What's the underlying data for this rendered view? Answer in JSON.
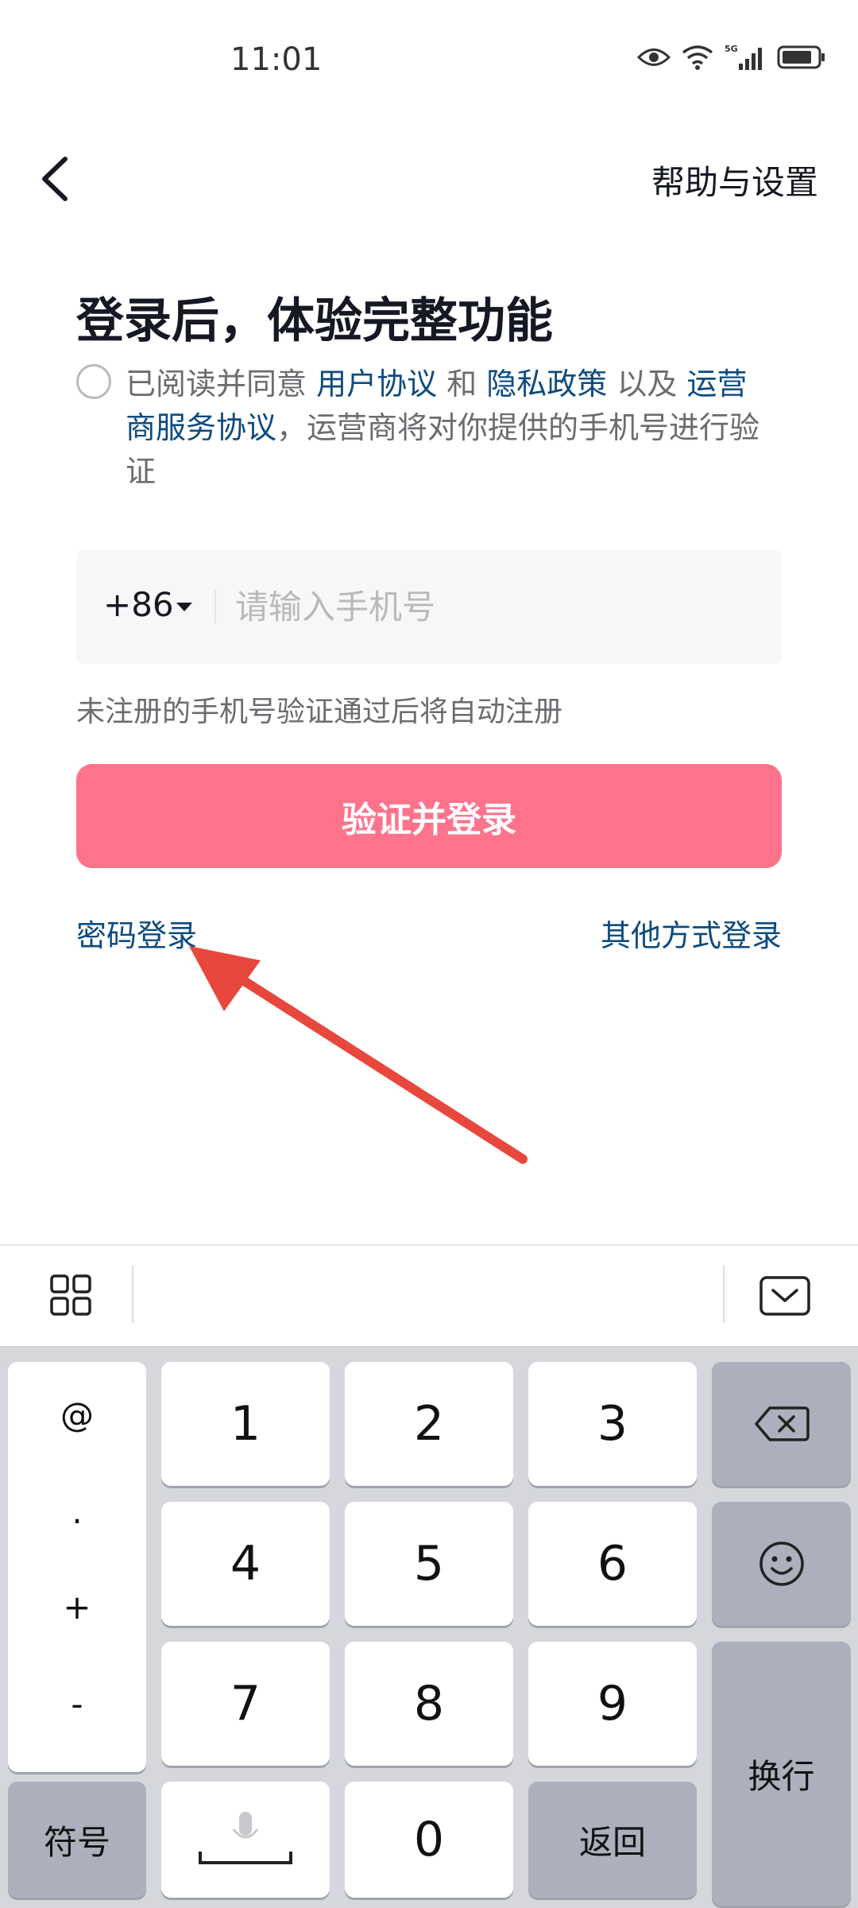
{
  "status_bar": {
    "time": "11:01"
  },
  "header": {
    "help": "帮助与设置"
  },
  "title": "登录后，体验完整功能",
  "agreement": {
    "part1": "已阅读并同意 ",
    "user_agreement": "用户协议",
    "and": " 和 ",
    "privacy_policy": "隐私政策",
    "and_also": " 以及 ",
    "operator_agreement": "运营商服务协议",
    "part2": "，运营商将对你提供的手机号进行验证"
  },
  "phone": {
    "country_code": "+86",
    "placeholder": "请输入手机号"
  },
  "hint": "未注册的手机号验证通过后将自动注册",
  "login_button": "验证并登录",
  "password_login": "密码登录",
  "other_login": "其他方式登录",
  "keyboard": {
    "symbols": [
      "@",
      ".",
      "+",
      "-"
    ],
    "digits": [
      "1",
      "2",
      "3",
      "4",
      "5",
      "6",
      "7",
      "8",
      "9",
      "0"
    ],
    "symbol_key": "符号",
    "back_key": "返回",
    "newline_key": "换行"
  }
}
